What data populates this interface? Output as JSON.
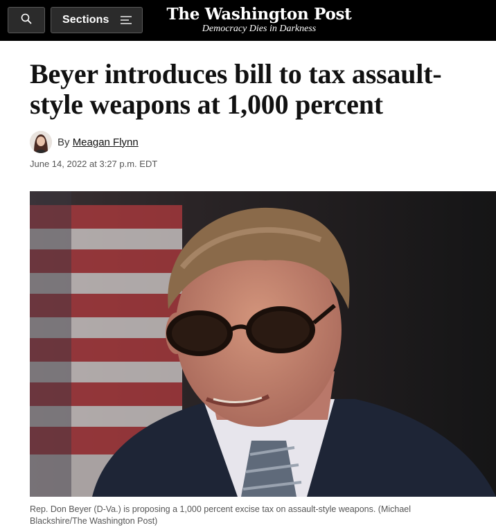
{
  "header": {
    "search_icon": "search-icon",
    "sections_label": "Sections",
    "menu_icon": "hamburger-menu-icon",
    "brand": "The Washington Post",
    "tagline": "Democracy Dies in Darkness"
  },
  "article": {
    "headline": "Beyer introduces bill to tax assault-style weapons at 1,000 percent",
    "byline_prefix": "By",
    "author": "Meagan Flynn",
    "timestamp": "June 14, 2022 at 3:27 p.m. EDT",
    "caption": "Rep. Don Beyer (D-Va.) is proposing a 1,000 percent excise tax on assault-style weapons. (Michael Blackshire/The Washington Post)"
  },
  "colors": {
    "topbar": "#000000",
    "button_bg": "#2b2b2b",
    "text": "#111111",
    "meta": "#555555"
  }
}
